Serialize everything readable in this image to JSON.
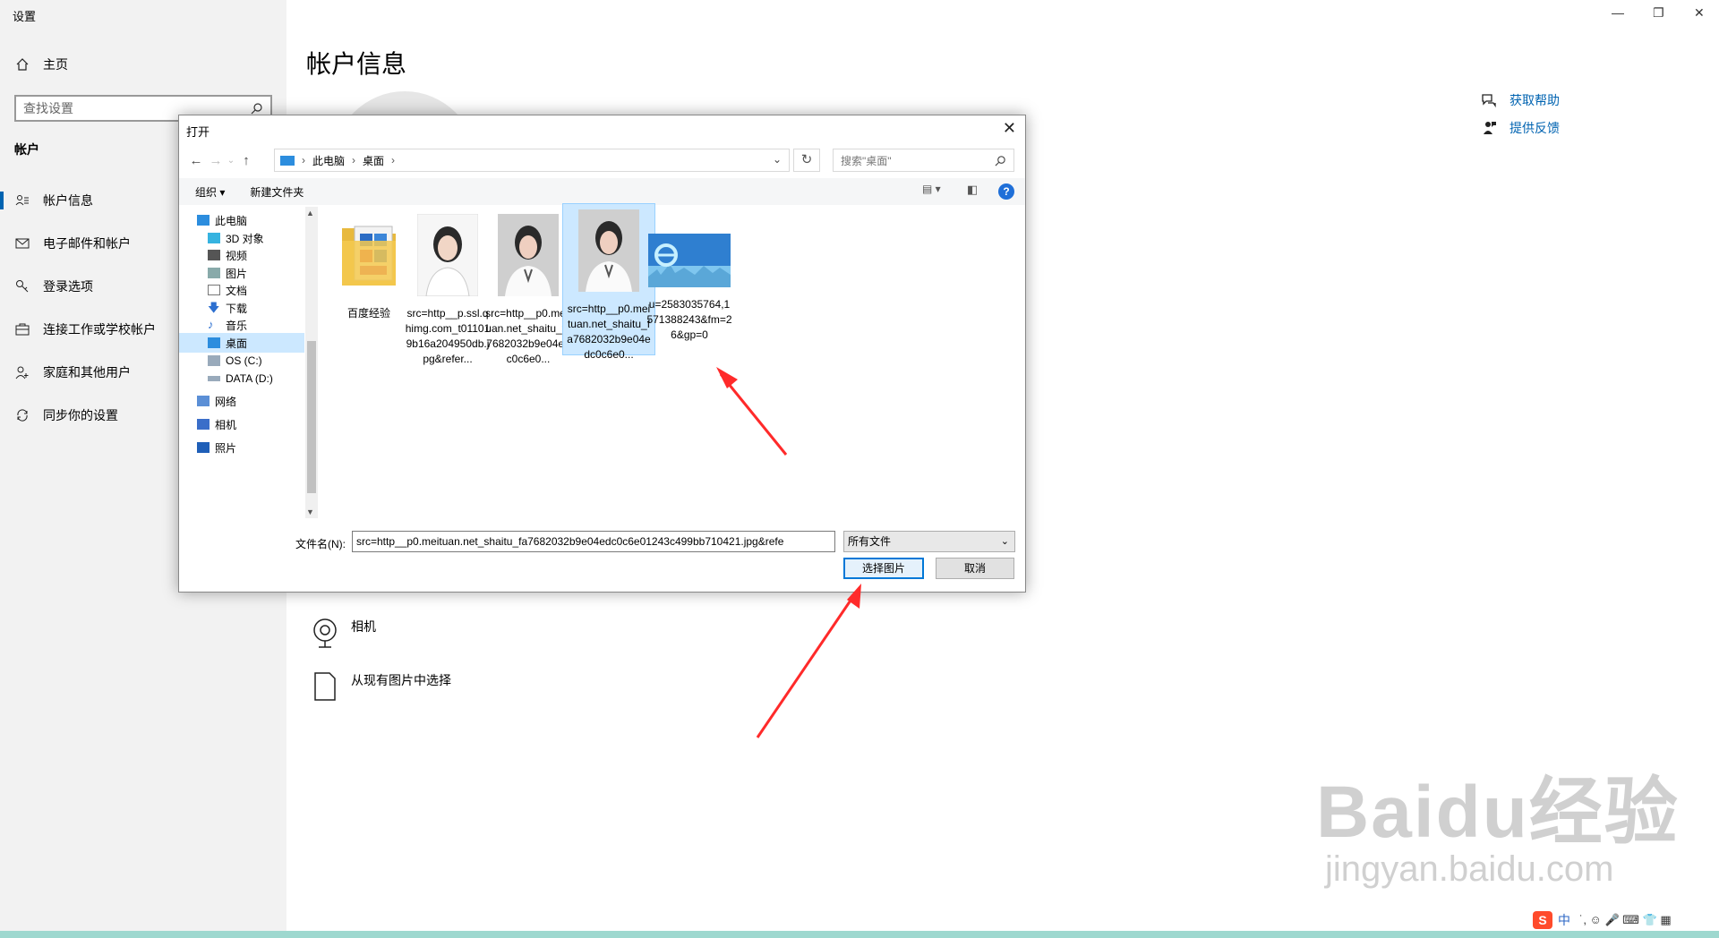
{
  "settings": {
    "app_title": "设置",
    "home": "主页",
    "search_placeholder": "查找设置",
    "section": "帐户",
    "nav": [
      {
        "label": "帐户信息",
        "icon": "person-list-icon"
      },
      {
        "label": "电子邮件和帐户",
        "icon": "mail-icon"
      },
      {
        "label": "登录选项",
        "icon": "key-icon"
      },
      {
        "label": "连接工作或学校帐户",
        "icon": "briefcase-icon"
      },
      {
        "label": "家庭和其他用户",
        "icon": "person-add-icon"
      },
      {
        "label": "同步你的设置",
        "icon": "sync-icon"
      }
    ],
    "main_title": "帐户信息",
    "help_links": [
      "获取帮助",
      "提供反馈"
    ],
    "create_options": [
      "相机",
      "从现有图片中选择"
    ]
  },
  "dialog": {
    "title": "打开",
    "breadcrumb": [
      "此电脑",
      "桌面"
    ],
    "search_placeholder": "搜索\"桌面\"",
    "toolbar": {
      "organize": "组织 ▾",
      "new_folder": "新建文件夹"
    },
    "tree": [
      "此电脑",
      "3D 对象",
      "视频",
      "图片",
      "文档",
      "下载",
      "音乐",
      "桌面",
      "OS (C:)",
      "DATA (D:)",
      "网络",
      "相机",
      "照片"
    ],
    "selected_tree_item": "桌面",
    "files": [
      {
        "name": "百度经验",
        "type": "folder"
      },
      {
        "name": "src=http__p.ssl.qhimg.com_t011019b16a204950db.jpg&refer...",
        "type": "photo"
      },
      {
        "name": "src=http__p0.meituan.net_shaitu_fa7682032b9e04edc0c6e0...",
        "type": "photo"
      },
      {
        "name": "src=http__p0.meituan.net_shaitu_fa7682032b9e04edc0c6e0...",
        "type": "photo",
        "selected": true
      },
      {
        "name": "u=2583035764,1571388243&fm=26&gp=0",
        "type": "ie-image"
      }
    ],
    "filename_label": "文件名(N):",
    "filename_value": "src=http__p0.meituan.net_shaitu_fa7682032b9e04edc0c6e01243c499bb710421.jpg&refe",
    "filter": "所有文件",
    "ok": "选择图片",
    "cancel": "取消"
  },
  "watermark": {
    "brand": "Baidu经验",
    "url": "jingyan.baidu.com"
  },
  "ime": {
    "logo": "S",
    "lang": "中"
  }
}
